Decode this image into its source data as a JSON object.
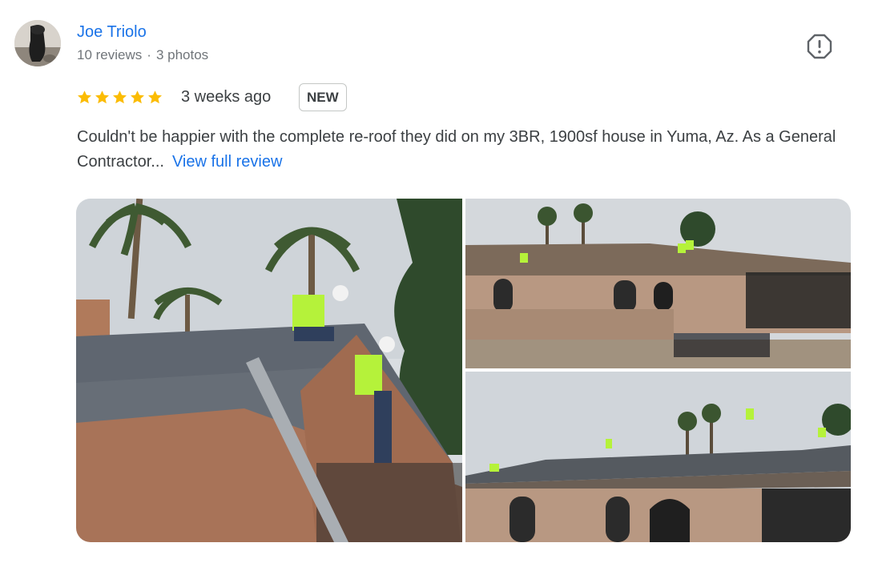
{
  "reviewer": {
    "name": "Joe Triolo",
    "reviews": "10 reviews",
    "separator": "·",
    "photos": "3 photos"
  },
  "rating": {
    "stars": 5,
    "max": 5,
    "star_color": "#fbbc04"
  },
  "time_ago": "3 weeks ago",
  "badge": "NEW",
  "review": {
    "text": "Couldn't be happier with the complete re-roof they did on my 3BR, 1900sf house in Yuma, Az. As a General Contractor...",
    "more_link": "View full review"
  },
  "icons": {
    "report": "report-flag-icon",
    "star": "star-icon"
  },
  "colors": {
    "link": "#1a73e8",
    "text": "#3c4043",
    "meta": "#70757a"
  }
}
